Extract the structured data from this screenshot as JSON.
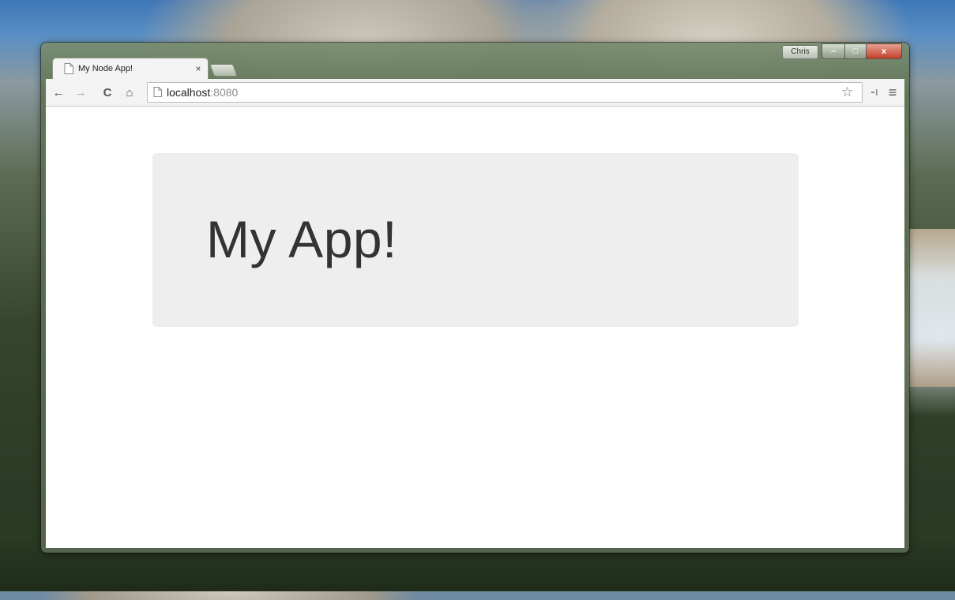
{
  "browser": {
    "profile_name": "Chris",
    "tab": {
      "title": "My Node App!",
      "close_glyph": "×"
    },
    "toolbar": {
      "back_glyph": "←",
      "forward_glyph": "→",
      "reload_glyph": "C",
      "home_glyph": "⌂",
      "url_host": "localhost",
      "url_port": ":8080",
      "star_glyph": "☆",
      "menu_glyph": "≡"
    },
    "window_controls": {
      "minimize": "–",
      "maximize": "□",
      "close": "x"
    }
  },
  "page": {
    "heading": "My App!"
  },
  "icons": [
    "page-icon",
    "back-arrow-icon",
    "forward-arrow-icon",
    "reload-icon",
    "home-icon",
    "star-icon",
    "extension-icon",
    "menu-icon"
  ],
  "colors": {
    "jumbotron_bg": "#eeeeee",
    "heading_text": "#333333",
    "close_button": "#c2402a"
  }
}
